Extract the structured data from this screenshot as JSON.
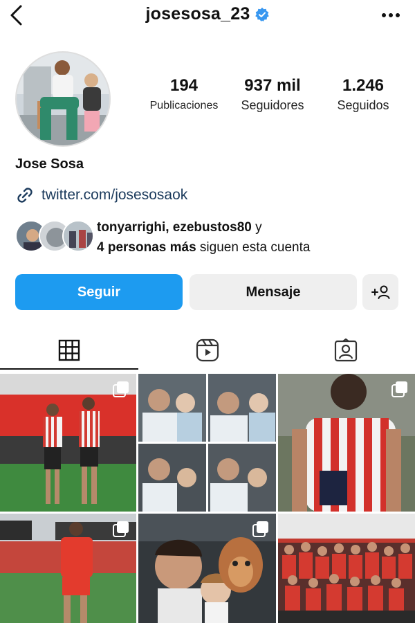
{
  "header": {
    "username": "josesosa_23",
    "icons": {
      "back": "chevron-left-icon",
      "verified": "verified-badge-icon",
      "more": "more-dots-icon"
    }
  },
  "profile": {
    "full_name": "Jose Sosa",
    "stats": {
      "posts_value": "194",
      "posts_label": "Publicaciones",
      "followers_value": "937 mil",
      "followers_label": "Seguidores",
      "following_value": "1.246",
      "following_label": "Seguidos"
    },
    "link": "twitter.com/josesosaok"
  },
  "mutuals": {
    "names": "tonyarrighi, ezebustos80",
    "connector": " y",
    "more_bold": "4 personas más",
    "suffix": " siguen esta cuenta"
  },
  "actions": {
    "follow_label": "Seguir",
    "message_label": "Mensaje",
    "add_icon": "add-person-icon"
  },
  "tabs": [
    {
      "name": "grid",
      "icon": "grid-icon",
      "active": true
    },
    {
      "name": "reels",
      "icon": "reels-icon",
      "active": false
    },
    {
      "name": "tagged",
      "icon": "tagged-icon",
      "active": false
    }
  ],
  "posts": [
    {
      "multi": true,
      "caption": ""
    },
    {
      "multi": false,
      "caption": ""
    },
    {
      "multi": true,
      "caption": ""
    },
    {
      "multi": true,
      "caption": ""
    },
    {
      "multi": true,
      "caption": ""
    },
    {
      "multi": false,
      "caption": ""
    }
  ],
  "colors": {
    "accent": "#1d9bf0",
    "verified": "#3897f0",
    "link": "#1b3a5c"
  }
}
